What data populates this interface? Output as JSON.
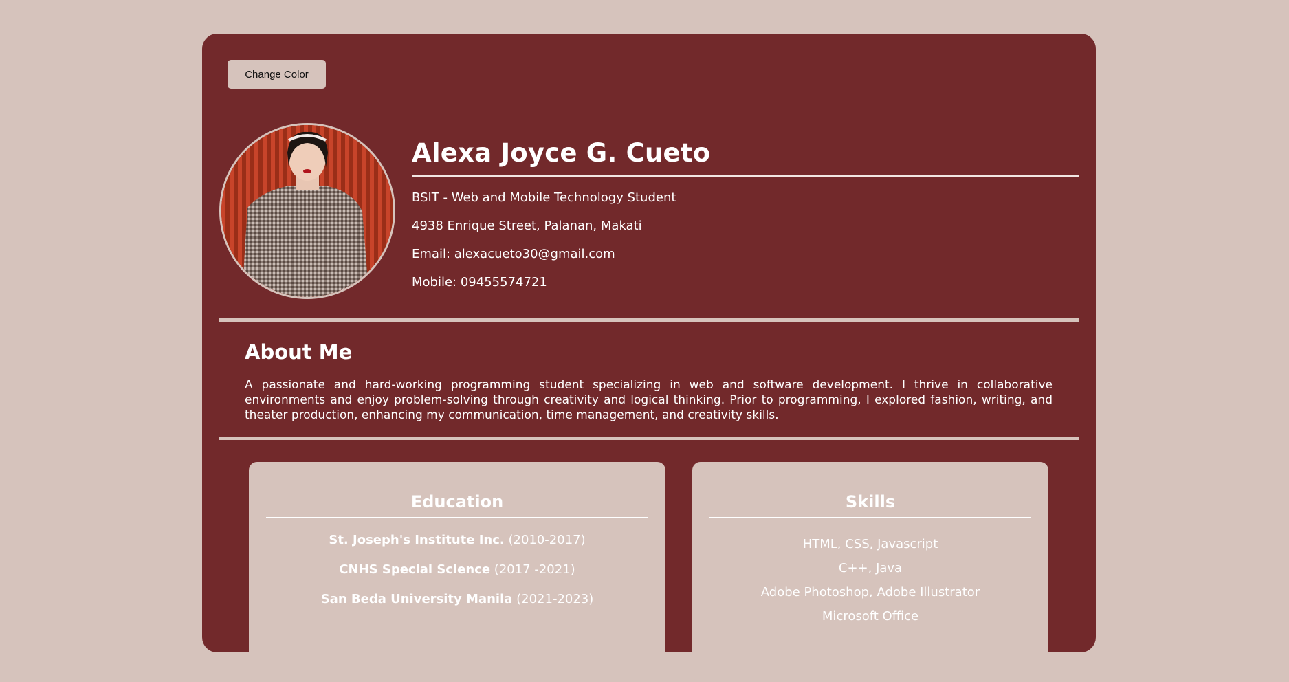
{
  "toolbar": {
    "change_color_label": "Change Color"
  },
  "profile": {
    "name": "Alexa Joyce G. Cueto",
    "title": "BSIT - Web and Mobile Technology Student",
    "address": "4938 Enrique Street, Palanan, Makati",
    "email": "Email: alexacueto30@gmail.com",
    "mobile": "Mobile: 09455574721"
  },
  "about": {
    "heading": "About Me",
    "text": "A passionate and hard-working programming student specializing in web and software development. I thrive in collaborative environments and enjoy problem-solving through creativity and logical thinking. Prior to programming, I explored fashion, writing, and theater production, enhancing my communication, time management, and creativity skills."
  },
  "education": {
    "heading": "Education",
    "items": [
      {
        "school": "St. Joseph's Institute Inc.",
        "years": "(2010-2017)"
      },
      {
        "school": "CNHS Special Science",
        "years": "(2017 -2021)"
      },
      {
        "school": "San Beda University Manila",
        "years": "(2021-2023)"
      }
    ]
  },
  "skills": {
    "heading": "Skills",
    "items": [
      "HTML, CSS, Javascript",
      "C++, Java",
      "Adobe Photoshop, Adobe Illustrator",
      "Microsoft Office"
    ]
  },
  "colors": {
    "page_background": "#d6c3bc",
    "card_background": "#72292b",
    "text": "#ffffff"
  },
  "icons": {
    "avatar": "profile-photo"
  }
}
